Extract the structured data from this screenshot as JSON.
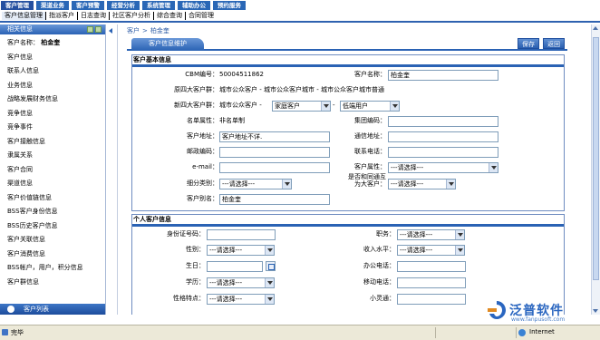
{
  "top_tabs": [
    {
      "label": "客户管理",
      "active": true
    },
    {
      "label": "渠道业务"
    },
    {
      "label": "客户预警"
    },
    {
      "label": "经营分析"
    },
    {
      "label": "系统管理"
    },
    {
      "label": "辅助办公"
    },
    {
      "label": "预约服务"
    }
  ],
  "sub_tabs": [
    "客户信息管理",
    "指派客户",
    "日志查询",
    "社区客户分析",
    "综合查询",
    "合同管理"
  ],
  "sidebar": {
    "title": "相关信息",
    "customer_label": "客户名称：",
    "customer_name": "柏金奎",
    "items": [
      "客户信息",
      "联系人信息",
      "业务信息",
      "战略发展财务信息",
      "竞争信息",
      "竞争事件",
      "客户接触信息",
      "隶属关系",
      "客户合同",
      "渠道信息",
      "客户价值链信息",
      "BSS客户身份信息",
      "BSS历史客户信息",
      "客户关联信息",
      "客户消费信息",
      "BSS帐户，用户，积分信息",
      "客户群信息"
    ],
    "footer": "客户列表"
  },
  "breadcrumb": {
    "root": "客户",
    "sep": ">",
    "current": "柏金奎"
  },
  "main": {
    "tab": "客户信息维护",
    "save_button": "保存",
    "back_button": "返回"
  },
  "basic": {
    "title": "客户基本信息",
    "cbm_label": "CBM编号：",
    "cbm_value": "50004511862",
    "name_label": "客户名称：",
    "name_value": "柏金奎",
    "orig_group_label": "原四大客户群：",
    "orig_group_value": "城市公众客户 - 城市公众客户城市 - 城市公众客户城市普通",
    "new_group_label": "新四大客户群：",
    "new_group_prefix": "城市公众客户 -",
    "new_group_sel1": "家庭客户",
    "new_group_sel2": "低端用户",
    "single_attr_label": "名单属性：",
    "single_attr_value": "非名单制",
    "group_code_label": "集团编码：",
    "address_label": "客户地址：",
    "address_value": "客户地址不详.",
    "comm_address_label": "通信地址：",
    "postcode_label": "邮政编码：",
    "contact_phone_label": "联系电话：",
    "email_label": "e-mail：",
    "attr_label": "客户属性：",
    "attr_value": "---请选择---",
    "segment_label": "细分类别：",
    "segment_value": "---请选择---",
    "major_label_line1": "是否和同通互",
    "major_label_line2": "为大客户：",
    "major_value": "---请选择---",
    "alias_label": "客户别名：",
    "alias_value": "柏金奎"
  },
  "personal": {
    "title": "个人客户信息",
    "id_label": "身份证号码：",
    "job_label": "职务：",
    "job_value": "---请选择---",
    "gender_label": "性别：",
    "gender_value": "---请选择---",
    "income_label": "收入水平：",
    "income_value": "---请选择---",
    "birthday_label": "生日：",
    "office_phone_label": "办公电话：",
    "education_label": "学历：",
    "education_value": "---请选择---",
    "mobile_label": "移动电话：",
    "personality_label": "性格特点：",
    "personality_value": "---请选择---",
    "pas_label": "小灵通："
  },
  "status": {
    "done": "完毕",
    "zone": "Internet"
  },
  "watermark": {
    "brand": "泛普软件",
    "url": "www.fanpusoft.com"
  }
}
